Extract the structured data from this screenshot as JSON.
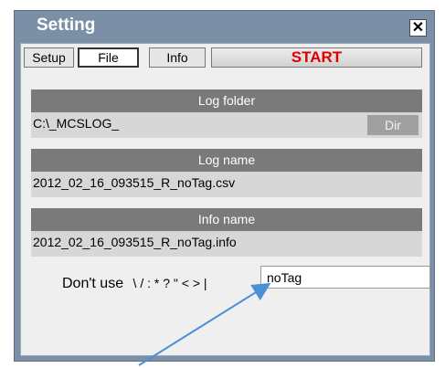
{
  "window": {
    "title": "Setting",
    "close_glyph": "✕"
  },
  "tabs": [
    {
      "label": "Setup",
      "active": false
    },
    {
      "label": "File",
      "active": true
    },
    {
      "label": "Info",
      "active": false
    }
  ],
  "start_button": {
    "label": "START",
    "color": "#e00000"
  },
  "log_folder": {
    "header": "Log folder",
    "value": "C:\\_MCSLOG_",
    "dir_label": "Dir"
  },
  "log_name": {
    "header": "Log name",
    "value": "2012_02_16_093515_R_noTag.csv"
  },
  "info_name": {
    "header": "Info name",
    "value": "2012_02_16_093515_R_noTag.info"
  },
  "tag": {
    "hint_prefix": "Don't use",
    "hint_chars": "\\ / : * ? \" < > |",
    "value": "noTag"
  },
  "annotation": {
    "icon": "arrow-icon",
    "color": "#4a90d9"
  }
}
